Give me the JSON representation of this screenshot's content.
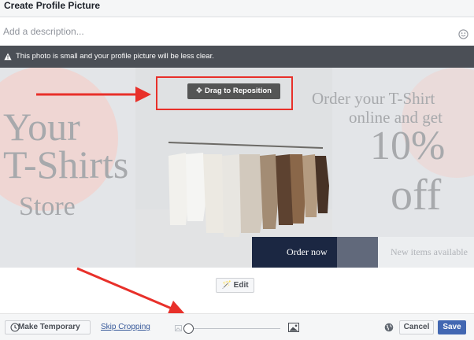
{
  "dialog": {
    "title": "Create Profile Picture",
    "description_placeholder": "Add a description...",
    "warning": "This photo is small and your profile picture will be less clear."
  },
  "image": {
    "left_line1": "Your",
    "left_line2": "T-Shirts",
    "left_line3": "Store",
    "right_line1": "Order your T-Shirt",
    "right_line2": "online and get",
    "right_line3": "10%",
    "right_line4": "off",
    "order_now": "Order now",
    "new_items": "New items available",
    "colors": {
      "headline_grey": "#a7a9ac",
      "circle_pink": "#efd4d0",
      "navy": "#1b2742",
      "dark_text": "#1b2742"
    }
  },
  "crop": {
    "drag_label": "Drag to Reposition",
    "edit_label": "Edit"
  },
  "footer": {
    "make_temporary": "Make Temporary",
    "skip_cropping": "Skip Cropping",
    "cancel": "Cancel",
    "save": "Save",
    "zoom_level": 0
  },
  "annotation": {
    "highlight_color": "#e8302a"
  },
  "icons": {
    "emoji": "smiley-icon",
    "warning": "warning-triangle-icon",
    "move": "move-arrows-icon",
    "wand": "magic-wand-icon",
    "clock": "clock-icon",
    "globe": "globe-icon",
    "zoom_out": "image-small-icon",
    "zoom_in": "image-large-icon"
  }
}
